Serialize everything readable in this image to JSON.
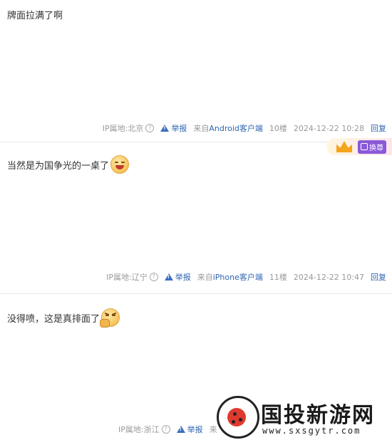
{
  "posts": [
    {
      "content": "牌面拉满了啊",
      "meta": {
        "ip": "IP属地:北京",
        "report": "举报",
        "client_prefix": "来自",
        "client_device": "Android客户端",
        "floor": "10楼",
        "time": "2024-12-22 10:28",
        "reply": "回复"
      }
    },
    {
      "content": "当然是为国争光的一桌了",
      "meta": {
        "ip": "IP属地:辽宁",
        "report": "举报",
        "client_prefix": "来自",
        "client_device": "iPhone客户端",
        "floor": "11楼",
        "time": "2024-12-22 10:47",
        "reply": "回复"
      }
    },
    {
      "content": "没得喷，这是真排面了",
      "meta": {
        "ip": "IP属地:浙江",
        "report": "举报",
        "client_prefix": "来"
      }
    }
  ],
  "badge": {
    "label": "换尊"
  },
  "watermark": {
    "title": "国投新游网",
    "url": "www.sxsgytr.com"
  },
  "icons": [
    "question-icon",
    "warning-icon",
    "crown-icon",
    "laughing-emoji",
    "fist-emoji"
  ],
  "colors": {
    "link": "#2d64b3",
    "meta": "#999999",
    "divider": "#e5e5e5",
    "badge_purple": "#8b58d8",
    "crown": "#f3a51b"
  }
}
